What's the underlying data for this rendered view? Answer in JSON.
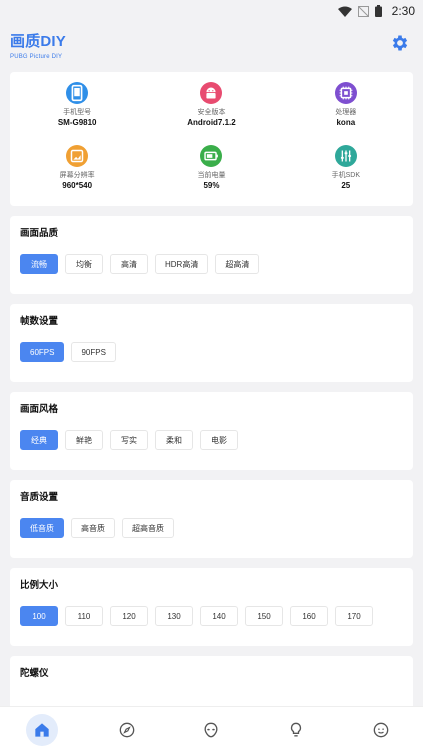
{
  "status_bar": {
    "time": "2:30"
  },
  "header": {
    "title": "画质DIY",
    "subtitle": "PUBG Picture DIY"
  },
  "device_info": [
    {
      "label": "手机型号",
      "value": "SM-G9810",
      "icon": "phone-icon",
      "color": "#2f8fe8"
    },
    {
      "label": "安全版本",
      "value": "Android7.1.2",
      "icon": "android-icon",
      "color": "#e84b70"
    },
    {
      "label": "处理器",
      "value": "kona",
      "icon": "chip-icon",
      "color": "#7e4fd0"
    },
    {
      "label": "屏幕分辨率",
      "value": "960*540",
      "icon": "image-icon",
      "color": "#f0a033"
    },
    {
      "label": "当前电量",
      "value": "59%",
      "icon": "battery-icon",
      "color": "#3aae4a"
    },
    {
      "label": "手机SDK",
      "value": "25",
      "icon": "equalizer-icon",
      "color": "#2fa89a"
    }
  ],
  "sections": [
    {
      "title": "画面品质",
      "options": [
        "流畅",
        "均衡",
        "高清",
        "HDR高清",
        "超高清"
      ],
      "selected": 0
    },
    {
      "title": "帧数设置",
      "options": [
        "60FPS",
        "90FPS"
      ],
      "selected": 0
    },
    {
      "title": "画面风格",
      "options": [
        "经典",
        "鲜艳",
        "写实",
        "柔和",
        "电影"
      ],
      "selected": 0
    },
    {
      "title": "音质设置",
      "options": [
        "低音质",
        "高音质",
        "超高音质"
      ],
      "selected": 0
    },
    {
      "title": "比例大小",
      "options": [
        "100",
        "110",
        "120",
        "130",
        "140",
        "150",
        "160",
        "170"
      ],
      "selected": 0
    },
    {
      "title": "陀螺仪",
      "options": [],
      "selected": -1
    }
  ],
  "bottom_nav": [
    {
      "icon": "home-icon",
      "active": true
    },
    {
      "icon": "compass-icon",
      "active": false
    },
    {
      "icon": "alien-icon",
      "active": false
    },
    {
      "icon": "lightbulb-icon",
      "active": false
    },
    {
      "icon": "smiley-icon",
      "active": false
    }
  ],
  "colors": {
    "accent": "#4b86f0",
    "title": "#3b7bea",
    "background": "#f2f2f4"
  }
}
